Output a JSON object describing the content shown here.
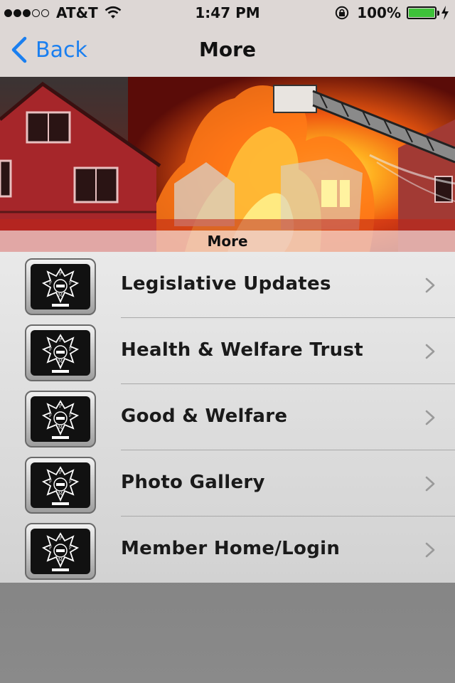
{
  "status_bar": {
    "carrier": "AT&T",
    "time": "1:47 PM",
    "battery": "100%",
    "signal_bars_filled": 3,
    "signal_bars_total": 5,
    "battery_level": 1.0,
    "icons": [
      "wifi-icon",
      "orientation-lock-icon",
      "battery-icon",
      "charging-bolt-icon"
    ]
  },
  "nav": {
    "back_label": "Back",
    "title": "More"
  },
  "hero": {
    "caption": "More"
  },
  "menu": {
    "items": [
      {
        "label": "Legislative Updates"
      },
      {
        "label": "Health & Welfare Trust"
      },
      {
        "label": "Good & Welfare"
      },
      {
        "label": "Photo Gallery"
      },
      {
        "label": "Member Home/Login"
      }
    ]
  },
  "colors": {
    "accent": "#1a7ff0",
    "battery_fill": "#3ec23a",
    "list_text": "#1a1a1a"
  }
}
